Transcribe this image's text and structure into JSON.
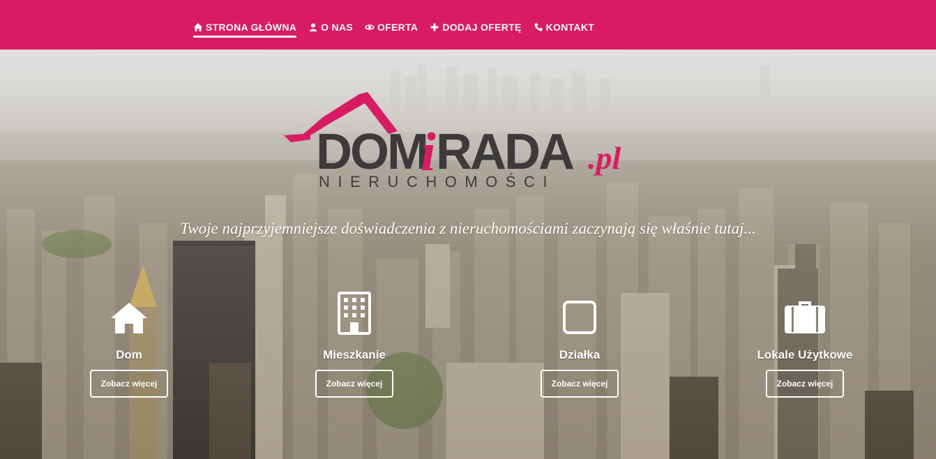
{
  "nav": {
    "items": [
      {
        "label": "STRONA GŁÓWNA",
        "icon": "home-icon",
        "active": true
      },
      {
        "label": "O NAS",
        "icon": "user-icon",
        "active": false
      },
      {
        "label": "OFERTA",
        "icon": "eye-icon",
        "active": false
      },
      {
        "label": "DODAJ OFERTĘ",
        "icon": "plus-icon",
        "active": false
      },
      {
        "label": "KONTAKT",
        "icon": "phone-icon",
        "active": false
      }
    ]
  },
  "logo": {
    "text_dom": "DOM",
    "text_i": "i",
    "text_rada": "RADA",
    "text_pl": ".pl",
    "subtitle": "NIERUCHOMOŚCI"
  },
  "tagline": "Twoje najprzyjemniejsze doświadczenia z nieruchomościami zaczynają się właśnie tutaj...",
  "categories": [
    {
      "title": "Dom",
      "button": "Zobacz więcej",
      "icon": "house-icon"
    },
    {
      "title": "Mieszkanie",
      "button": "Zobacz więcej",
      "icon": "building-icon"
    },
    {
      "title": "Działka",
      "button": "Zobacz więcej",
      "icon": "square-icon"
    },
    {
      "title": "Lokale Użytkowe",
      "button": "Zobacz więcej",
      "icon": "briefcase-icon"
    }
  ],
  "colors": {
    "accent": "#d81b63",
    "logo_dark": "#3d3a3b",
    "white": "#ffffff"
  }
}
